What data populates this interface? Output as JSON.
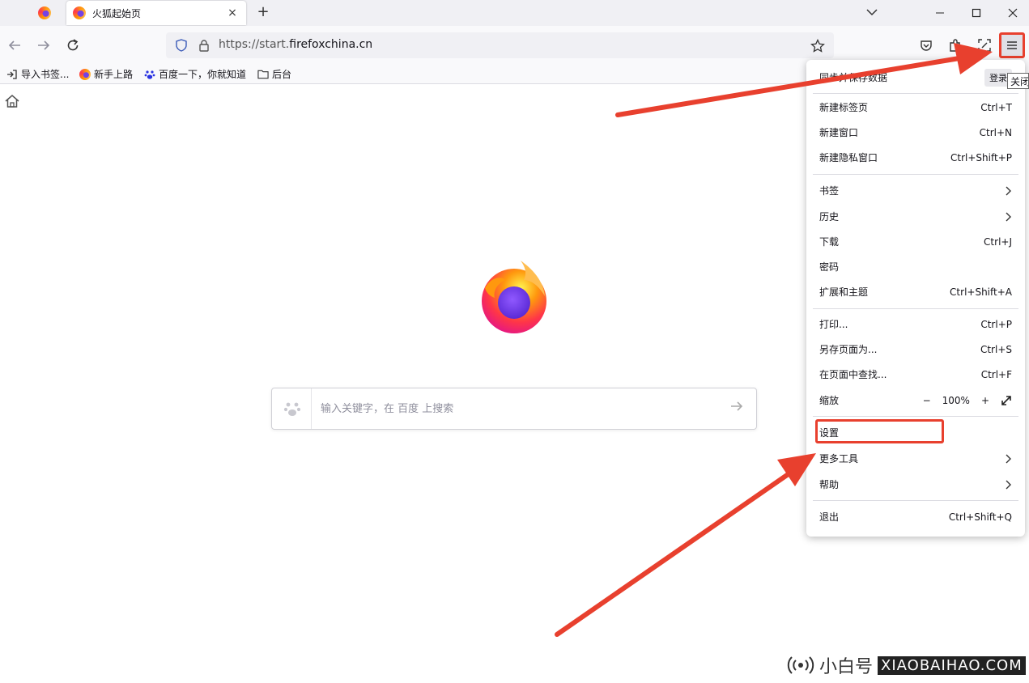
{
  "browser": {
    "active_tab_title": "火狐起始页",
    "tab_close": "×",
    "new_tab": "+",
    "url_prefix": "https://start.",
    "url_domain": "firefoxchina.cn",
    "tooltip": "关闭"
  },
  "bookmarks": [
    {
      "label": "导入书签...",
      "icon": "import-icon"
    },
    {
      "label": "新手上路",
      "icon": "firefox-icon"
    },
    {
      "label": "百度一下，你就知道",
      "icon": "baidu-paw-icon"
    },
    {
      "label": "后台",
      "icon": "folder-icon"
    }
  ],
  "search": {
    "placeholder": "输入关键字，在 百度 上搜索"
  },
  "menu": {
    "sync_label": "同步并保存数据",
    "login_label": "登录",
    "items": [
      {
        "label": "新建标签页",
        "shortcut": "Ctrl+T"
      },
      {
        "label": "新建窗口",
        "shortcut": "Ctrl+N"
      },
      {
        "label": "新建隐私窗口",
        "shortcut": "Ctrl+Shift+P"
      },
      {
        "label": "书签",
        "shortcut": ""
      },
      {
        "label": "历史",
        "shortcut": ""
      },
      {
        "label": "下载",
        "shortcut": "Ctrl+J"
      },
      {
        "label": "密码",
        "shortcut": ""
      },
      {
        "label": "扩展和主题",
        "shortcut": "Ctrl+Shift+A"
      },
      {
        "label": "打印...",
        "shortcut": "Ctrl+P"
      },
      {
        "label": "另存页面为...",
        "shortcut": "Ctrl+S"
      },
      {
        "label": "在页面中查找...",
        "shortcut": "Ctrl+F"
      },
      {
        "label": "缩放",
        "shortcut": ""
      },
      {
        "label": "设置",
        "shortcut": ""
      },
      {
        "label": "更多工具",
        "shortcut": ""
      },
      {
        "label": "帮助",
        "shortcut": ""
      },
      {
        "label": "退出",
        "shortcut": "Ctrl+Shift+Q"
      }
    ],
    "zoom": {
      "minus": "−",
      "value": "100%",
      "plus": "+"
    }
  },
  "watermark": {
    "cn": "小白号",
    "en": "XIAOBAIHAO.COM"
  },
  "colors": {
    "highlight": "#e8402e",
    "chrome_bg": "#f0f0f4",
    "toolbar_bg": "#f9f9fb"
  }
}
